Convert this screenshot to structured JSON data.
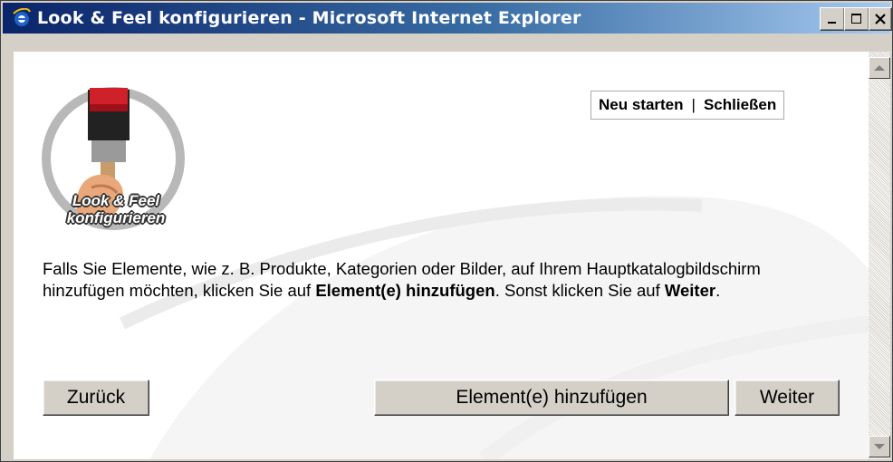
{
  "window": {
    "title": "Look & Feel konfigurieren - Microsoft Internet Explorer"
  },
  "toplinks": {
    "restart": "Neu starten",
    "separator": "|",
    "close": "Schließen"
  },
  "logo": {
    "line1": "Look & Feel",
    "line2": "konfigurieren"
  },
  "description": {
    "part1": "Falls Sie Elemente, wie z. B. Produkte, Kategorien oder Bilder, auf Ihrem Hauptkatalogbildschirm hinzufügen möchten, klicken Sie auf ",
    "bold1": "Element(e) hinzufügen",
    "part2": ". Sonst klicken Sie auf ",
    "bold2": "Weiter",
    "part3": "."
  },
  "buttons": {
    "back": "Zurück",
    "add": "Element(e) hinzufügen",
    "next": "Weiter"
  },
  "colors": {
    "titlebar_start": "#0a246a",
    "titlebar_end": "#a6caf0",
    "face": "#d4d0c8"
  }
}
